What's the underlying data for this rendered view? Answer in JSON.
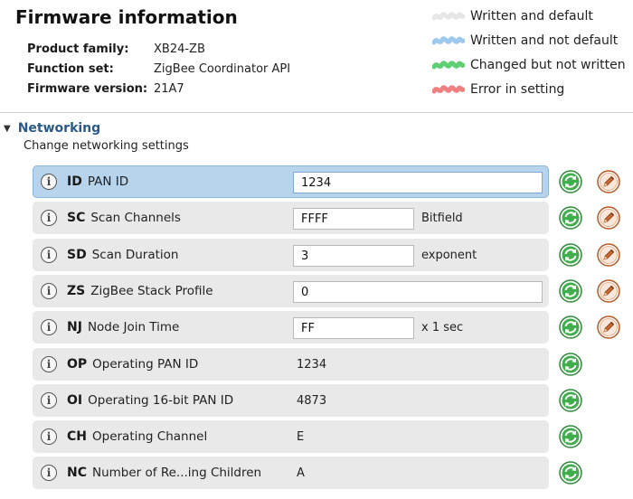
{
  "firmware": {
    "title": "Firmware information",
    "fields": [
      {
        "label": "Product family:",
        "value": "XB24-ZB"
      },
      {
        "label": "Function set:",
        "value": "ZigBee Coordinator API"
      },
      {
        "label": "Firmware version:",
        "value": "21A7"
      }
    ]
  },
  "legend": [
    {
      "label": "Written and default",
      "color": "#e6e6e6"
    },
    {
      "label": "Written and not default",
      "color": "#9dc9ee"
    },
    {
      "label": "Changed but not written",
      "color": "#5fcf74"
    },
    {
      "label": "Error in setting",
      "color": "#f07f7f"
    }
  ],
  "section": {
    "title": "Networking",
    "description": "Change networking settings"
  },
  "parameters": [
    {
      "code": "ID",
      "name": "PAN ID",
      "value": "1234",
      "unit": "",
      "editable": true,
      "input_size": "long",
      "selected": true
    },
    {
      "code": "SC",
      "name": "Scan Channels",
      "value": "FFFF",
      "unit": "Bitfield",
      "editable": true,
      "input_size": "short",
      "selected": false
    },
    {
      "code": "SD",
      "name": "Scan Duration",
      "value": "3",
      "unit": "exponent",
      "editable": true,
      "input_size": "short",
      "selected": false
    },
    {
      "code": "ZS",
      "name": "ZigBee Stack Profile",
      "value": "0",
      "unit": "",
      "editable": true,
      "input_size": "long",
      "selected": false
    },
    {
      "code": "NJ",
      "name": "Node Join Time",
      "value": "FF",
      "unit": "x 1 sec",
      "editable": true,
      "input_size": "short",
      "selected": false
    },
    {
      "code": "OP",
      "name": "Operating PAN ID",
      "value": "1234",
      "unit": "",
      "editable": false,
      "selected": false
    },
    {
      "code": "OI",
      "name": "Operating 16-bit PAN ID",
      "value": "4873",
      "unit": "",
      "editable": false,
      "selected": false
    },
    {
      "code": "CH",
      "name": "Operating Channel",
      "value": "E",
      "unit": "",
      "editable": false,
      "selected": false
    },
    {
      "code": "NC",
      "name": "Number of Re...ing Children",
      "value": "A",
      "unit": "",
      "editable": false,
      "selected": false
    }
  ],
  "icons": {
    "info": "info-icon",
    "read": "refresh-icon",
    "write": "pencil-icon",
    "info_glyph": "i"
  }
}
